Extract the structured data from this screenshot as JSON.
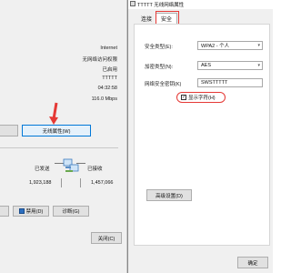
{
  "status_window": {
    "info_values": [
      "Internet",
      "无网络访问权限",
      "已启用",
      "TTTTT",
      "04:32:58",
      "116.0 Mbps"
    ],
    "wireless_props_button": "无线属性(W)",
    "activity": {
      "sent_label": "已发送",
      "received_label": "已接收",
      "sent_value": "1,923,188",
      "received_value": "1,457,066"
    },
    "bottom_buttons": [
      "禁用(D)",
      "诊断(G)"
    ],
    "close_button": "关闭(C)"
  },
  "properties_window": {
    "title": "TTTTT 无线网络属性",
    "tabs": [
      "连接",
      "安全"
    ],
    "fields": [
      {
        "label": "安全类型(E):",
        "value": "WPA2 - 个人"
      },
      {
        "label": "加密类型(N):",
        "value": "AES"
      },
      {
        "label": "网络安全密钥(K)",
        "value": "SWSTTTTT"
      }
    ],
    "show_chars_label": "显示字符(H)",
    "show_chars_checked": true,
    "advanced_button": "高级设置(D)",
    "ok_button": "确定",
    "accent_color": "#e53935"
  }
}
